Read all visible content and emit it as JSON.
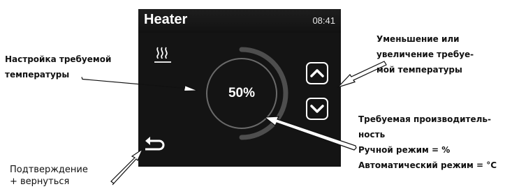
{
  "screen": {
    "title": "Heater",
    "time": "08:41",
    "dial_value": "50%",
    "dial_level_percent": 50,
    "icons": {
      "heat": "heat-waves-icon",
      "up": "chevron-up-icon",
      "down": "chevron-down-icon",
      "back": "back-arrow-icon"
    },
    "colors": {
      "background": "#141414",
      "arc": "#555555",
      "text": "#ffffff"
    }
  },
  "callouts": {
    "left": {
      "line1": "Настройка требуемой",
      "line2": "температуры"
    },
    "right": {
      "line1": "Уменьшение или",
      "line2": "увеличение требуе-",
      "line3": "мой температуры"
    },
    "bottom_right": {
      "line1": "Требуемая производитель-",
      "line2": "ность",
      "line3": "Ручной режим = %",
      "line4": "Автоматический режим = °C"
    },
    "bottom_left": {
      "line1": "Подтверждение",
      "line2": "+ вернуться"
    }
  }
}
